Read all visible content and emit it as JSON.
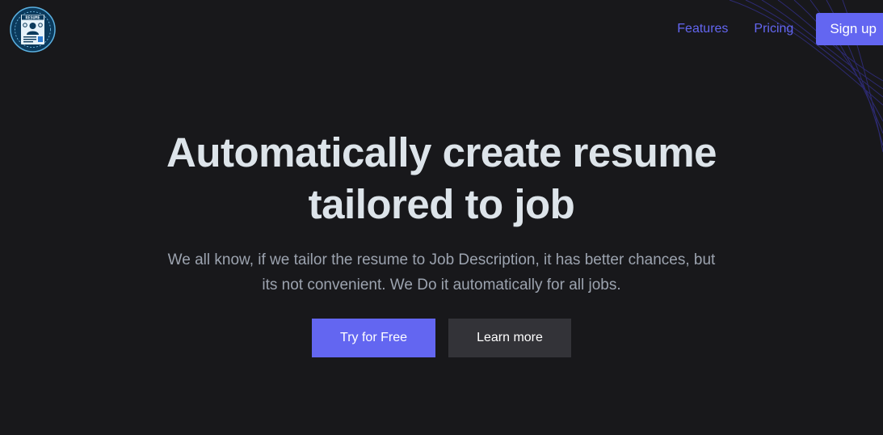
{
  "brand": {
    "logo_text": "RESUME",
    "icon": "resume-badge-icon"
  },
  "nav": {
    "items": [
      {
        "label": "Features"
      },
      {
        "label": "Pricing"
      }
    ],
    "signup_label": "Sign up"
  },
  "hero": {
    "title_line1": "Automatically create resume",
    "title_line2": "tailored to job",
    "subtitle_line1": "We all know, if we tailor the resume to Job Description, it has better chances, but",
    "subtitle_line2": "its not convenient. We Do it automatically for all jobs.",
    "primary_cta": "Try for Free",
    "secondary_cta": "Learn more"
  },
  "colors": {
    "background": "#18181b",
    "accent": "#6366f1",
    "title": "#dde4ea",
    "subtitle": "#9ca3af",
    "secondary_button": "#333338"
  }
}
